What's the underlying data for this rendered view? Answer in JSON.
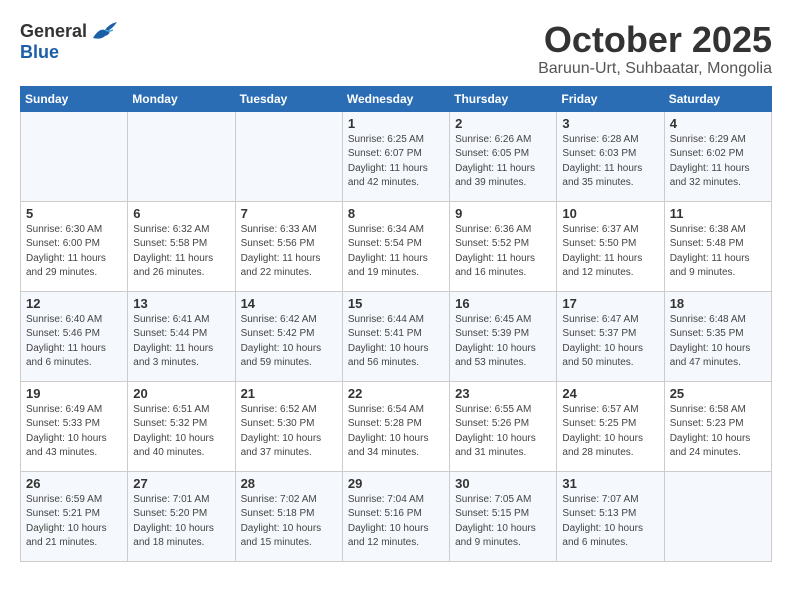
{
  "header": {
    "logo_general": "General",
    "logo_blue": "Blue",
    "title": "October 2025",
    "subtitle": "Baruun-Urt, Suhbaatar, Mongolia"
  },
  "days_of_week": [
    "Sunday",
    "Monday",
    "Tuesday",
    "Wednesday",
    "Thursday",
    "Friday",
    "Saturday"
  ],
  "weeks": [
    [
      {
        "day": "",
        "info": ""
      },
      {
        "day": "",
        "info": ""
      },
      {
        "day": "",
        "info": ""
      },
      {
        "day": "1",
        "info": "Sunrise: 6:25 AM\nSunset: 6:07 PM\nDaylight: 11 hours\nand 42 minutes."
      },
      {
        "day": "2",
        "info": "Sunrise: 6:26 AM\nSunset: 6:05 PM\nDaylight: 11 hours\nand 39 minutes."
      },
      {
        "day": "3",
        "info": "Sunrise: 6:28 AM\nSunset: 6:03 PM\nDaylight: 11 hours\nand 35 minutes."
      },
      {
        "day": "4",
        "info": "Sunrise: 6:29 AM\nSunset: 6:02 PM\nDaylight: 11 hours\nand 32 minutes."
      }
    ],
    [
      {
        "day": "5",
        "info": "Sunrise: 6:30 AM\nSunset: 6:00 PM\nDaylight: 11 hours\nand 29 minutes."
      },
      {
        "day": "6",
        "info": "Sunrise: 6:32 AM\nSunset: 5:58 PM\nDaylight: 11 hours\nand 26 minutes."
      },
      {
        "day": "7",
        "info": "Sunrise: 6:33 AM\nSunset: 5:56 PM\nDaylight: 11 hours\nand 22 minutes."
      },
      {
        "day": "8",
        "info": "Sunrise: 6:34 AM\nSunset: 5:54 PM\nDaylight: 11 hours\nand 19 minutes."
      },
      {
        "day": "9",
        "info": "Sunrise: 6:36 AM\nSunset: 5:52 PM\nDaylight: 11 hours\nand 16 minutes."
      },
      {
        "day": "10",
        "info": "Sunrise: 6:37 AM\nSunset: 5:50 PM\nDaylight: 11 hours\nand 12 minutes."
      },
      {
        "day": "11",
        "info": "Sunrise: 6:38 AM\nSunset: 5:48 PM\nDaylight: 11 hours\nand 9 minutes."
      }
    ],
    [
      {
        "day": "12",
        "info": "Sunrise: 6:40 AM\nSunset: 5:46 PM\nDaylight: 11 hours\nand 6 minutes."
      },
      {
        "day": "13",
        "info": "Sunrise: 6:41 AM\nSunset: 5:44 PM\nDaylight: 11 hours\nand 3 minutes."
      },
      {
        "day": "14",
        "info": "Sunrise: 6:42 AM\nSunset: 5:42 PM\nDaylight: 10 hours\nand 59 minutes."
      },
      {
        "day": "15",
        "info": "Sunrise: 6:44 AM\nSunset: 5:41 PM\nDaylight: 10 hours\nand 56 minutes."
      },
      {
        "day": "16",
        "info": "Sunrise: 6:45 AM\nSunset: 5:39 PM\nDaylight: 10 hours\nand 53 minutes."
      },
      {
        "day": "17",
        "info": "Sunrise: 6:47 AM\nSunset: 5:37 PM\nDaylight: 10 hours\nand 50 minutes."
      },
      {
        "day": "18",
        "info": "Sunrise: 6:48 AM\nSunset: 5:35 PM\nDaylight: 10 hours\nand 47 minutes."
      }
    ],
    [
      {
        "day": "19",
        "info": "Sunrise: 6:49 AM\nSunset: 5:33 PM\nDaylight: 10 hours\nand 43 minutes."
      },
      {
        "day": "20",
        "info": "Sunrise: 6:51 AM\nSunset: 5:32 PM\nDaylight: 10 hours\nand 40 minutes."
      },
      {
        "day": "21",
        "info": "Sunrise: 6:52 AM\nSunset: 5:30 PM\nDaylight: 10 hours\nand 37 minutes."
      },
      {
        "day": "22",
        "info": "Sunrise: 6:54 AM\nSunset: 5:28 PM\nDaylight: 10 hours\nand 34 minutes."
      },
      {
        "day": "23",
        "info": "Sunrise: 6:55 AM\nSunset: 5:26 PM\nDaylight: 10 hours\nand 31 minutes."
      },
      {
        "day": "24",
        "info": "Sunrise: 6:57 AM\nSunset: 5:25 PM\nDaylight: 10 hours\nand 28 minutes."
      },
      {
        "day": "25",
        "info": "Sunrise: 6:58 AM\nSunset: 5:23 PM\nDaylight: 10 hours\nand 24 minutes."
      }
    ],
    [
      {
        "day": "26",
        "info": "Sunrise: 6:59 AM\nSunset: 5:21 PM\nDaylight: 10 hours\nand 21 minutes."
      },
      {
        "day": "27",
        "info": "Sunrise: 7:01 AM\nSunset: 5:20 PM\nDaylight: 10 hours\nand 18 minutes."
      },
      {
        "day": "28",
        "info": "Sunrise: 7:02 AM\nSunset: 5:18 PM\nDaylight: 10 hours\nand 15 minutes."
      },
      {
        "day": "29",
        "info": "Sunrise: 7:04 AM\nSunset: 5:16 PM\nDaylight: 10 hours\nand 12 minutes."
      },
      {
        "day": "30",
        "info": "Sunrise: 7:05 AM\nSunset: 5:15 PM\nDaylight: 10 hours\nand 9 minutes."
      },
      {
        "day": "31",
        "info": "Sunrise: 7:07 AM\nSunset: 5:13 PM\nDaylight: 10 hours\nand 6 minutes."
      },
      {
        "day": "",
        "info": ""
      }
    ]
  ]
}
